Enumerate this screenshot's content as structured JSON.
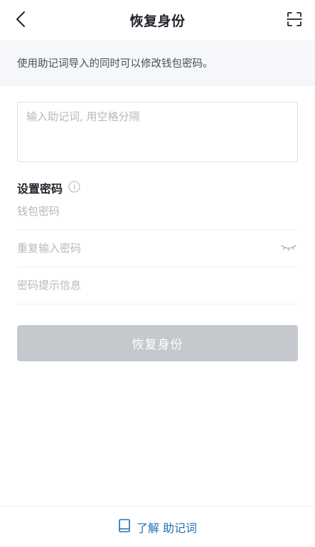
{
  "header": {
    "title": "恢复身份",
    "back_icon": "chevron-left-icon",
    "scan_icon": "scan-icon"
  },
  "notice": {
    "text": "使用助记词导入的同时可以修改钱包密码。"
  },
  "mnemonic": {
    "placeholder": "输入助记词, 用空格分隔",
    "value": ""
  },
  "password_section": {
    "label": "设置密码",
    "info_icon": "info-icon"
  },
  "fields": {
    "password_placeholder": "钱包密码",
    "repeat_placeholder": "重复输入密码",
    "hint_placeholder": "密码提示信息",
    "eye_icon": "eye-closed-icon"
  },
  "submit": {
    "label": "恢复身份",
    "state": "disabled"
  },
  "footer": {
    "icon": "book-icon",
    "link_label": "了解 助记词"
  },
  "colors": {
    "accent": "#1f6fb5",
    "button_disabled": "#c5c9ce",
    "notice_bg": "#f5f7fa",
    "placeholder": "#b4b8bf"
  }
}
